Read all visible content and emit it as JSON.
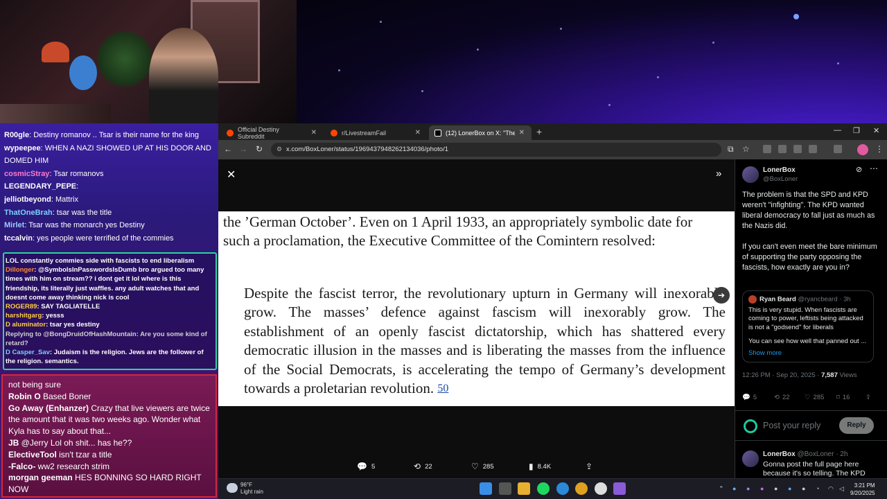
{
  "chat_top": [
    {
      "user": "R00gle",
      "user_color": "#ffffff",
      "text": ": Destiny romanov .. Tsar is their name for the king"
    },
    {
      "user": "wypeepee",
      "user_color": "#ffffff",
      "text": ": WHEN A NAZI SHOWED UP AT HIS DOOR AND"
    },
    {
      "user": "",
      "user_color": "#ffffff",
      "text": "DOMED HIM"
    },
    {
      "user": "cosmicStray",
      "user_color": "#ff7ad0",
      "text": ": Tsar romanovs"
    },
    {
      "user": "LEGENDARY_PEPE",
      "user_color": "#ffffff",
      "text": ":"
    },
    {
      "user": "jelliotbeyond",
      "user_color": "#ffffff",
      "text": ": Mattrix"
    },
    {
      "user": "ThatOneBrah",
      "user_color": "#7ad0ff",
      "text": ": tsar was the title"
    },
    {
      "user": "Mirlet",
      "user_color": "#a0c8ff",
      "text": ": Tsar was the monarch yes Destiny"
    },
    {
      "user": "tccalvin",
      "user_color": "#ffffff",
      "text": ": yes people were terrified of the commies"
    }
  ],
  "chat_mid": [
    {
      "user": "",
      "user_color": "#ffffff",
      "text": "LOL constantly commies side with fascists to end liberalism"
    },
    {
      "user": "Dillonger",
      "user_color": "#ff8a3a",
      "text": ": @SymbolsInPasswordsIsDumb bro argued too many times with him on stream?? i dont get it lol where is this friendship, its literally just waffles. any adult watches that and doesnt come away thinking nick is cool"
    },
    {
      "user": "ROGER89",
      "user_color": "#ffd040",
      "text": ": SAY TAGLIATELLE"
    },
    {
      "user": "harshitgarg",
      "user_color": "#ffd040",
      "text": ": yesss"
    },
    {
      "user": "D aluminator",
      "user_color": "#ffd040",
      "text": ": tsar yes destiny"
    },
    {
      "user": "",
      "user_color": "#cfcfcf",
      "text": "Replying to @BongDruidOfHashMountain: Are you some kind of retard?"
    },
    {
      "user": "D Casper_Sav",
      "user_color": "#7ad0ff",
      "text": ": Judaism is the religion. Jews are the follower of the religion. semantics."
    }
  ],
  "chat_bottom": [
    {
      "user": "",
      "user_color": "#ffffff",
      "text": "not being sure"
    },
    {
      "user": "Robin O",
      "user_color": "#ffffff",
      "text": " Based Boner"
    },
    {
      "user": "Go Away (Enhanzer)",
      "user_color": "#ffffff",
      "text": " Crazy that live viewers are twice the amount that it was two weeks ago. Wonder what Kyla has to say about that..."
    },
    {
      "user": "JB",
      "user_color": "#ffffff",
      "text": " @Jerry Lol oh shit... has he??"
    },
    {
      "user": "ElectiveTool",
      "user_color": "#ffffff",
      "text": " isn't tzar a title"
    },
    {
      "user": "-Falco-",
      "user_color": "#ffffff",
      "text": " ww2 research strim"
    },
    {
      "user": "morgan geeman",
      "user_color": "#ffffff",
      "text": " HES BONNING SO HARD RIGHT NOW"
    }
  ],
  "browser": {
    "tabs": [
      {
        "label": "Official Destiny Subreddit",
        "active": false
      },
      {
        "label": "r/LivestreamFail",
        "active": false
      },
      {
        "label": "(12) LonerBox on X: \"The probl",
        "active": true
      }
    ],
    "url": "x.com/BoxLoner/status/1969437948262134036/photo/1"
  },
  "photo": {
    "para1": "the ’German October’. Even on 1 April 1933, an appropriately symbolic date for such a proclamation, the Executive Committee of the Comintern resolved:",
    "quote": "Despite the fascist terror, the revolutionary upturn in Germany will inexorably grow. The masses’ defence against fascism will inexorably grow. The establishment of an openly fascist dictatorship, which has shattered every democratic illusion in the masses and is liberating the masses from the influence of the Social Democrats, is accelerating the tempo of Germany’s development towards a proletarian revolution.",
    "footnote": "50"
  },
  "viewer_actions": {
    "replies": "5",
    "reposts": "22",
    "likes": "285",
    "views": "8.4K"
  },
  "tweet": {
    "author": "LonerBox",
    "handle": "@BoxLoner",
    "text1": "The problem is that the SPD and KPD weren't \"infighting\". The KPD wanted liberal democracy to fall just as much as the Nazis did.",
    "text2": "If you can't even meet the bare minimum of supporting the party opposing the fascists, how exactly are you in?",
    "quote": {
      "author": "Ryan Beard",
      "handle": "@ryancbeard · 3h",
      "text1": "This is very stupid. When fascists are coming to power, leftists being attacked is not a \"godsend\" for liberals",
      "text2": "You can see how well that panned out ...",
      "show_more": "Show more"
    },
    "time": "12:26 PM · Sep 20, 2025 · ",
    "views": "7,587",
    "views_label": " Views",
    "replies": "5",
    "reposts": "22",
    "likes": "285",
    "bookmarks": "16",
    "reply_placeholder": "Post your reply",
    "reply_button": "Reply",
    "reply2": {
      "author": "LonerBox",
      "handle": "@BoxLoner · 2h",
      "text": "Gonna post the full page here because it's so telling. The KPD"
    }
  },
  "taskbar": {
    "temp": "96°F",
    "weather": "Light rain",
    "time": "3:21 PM",
    "date": "9/20/2025"
  }
}
